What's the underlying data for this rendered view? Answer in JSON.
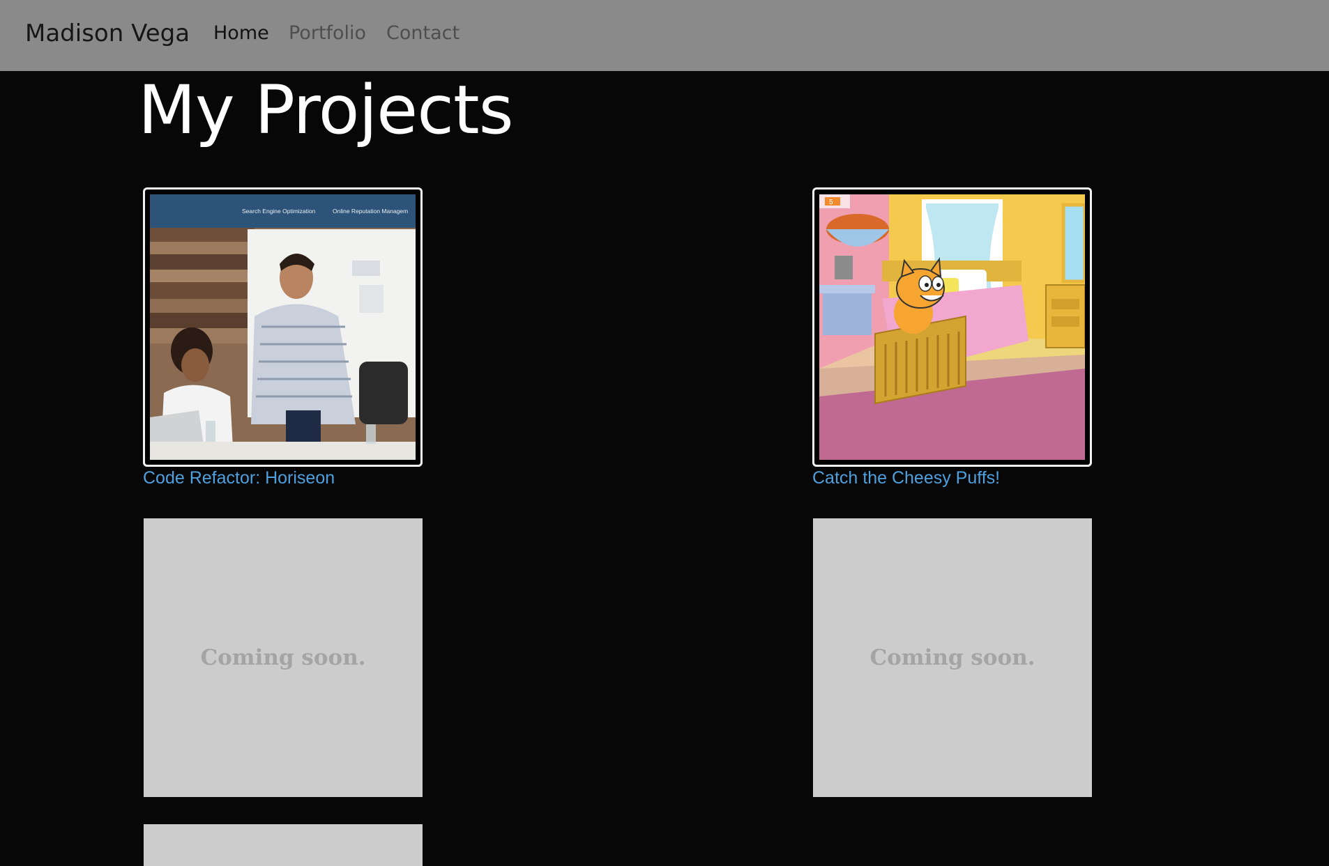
{
  "nav": {
    "brand": "Madison Vega",
    "links": [
      {
        "label": "Home",
        "active": true
      },
      {
        "label": "Portfolio",
        "active": false
      },
      {
        "label": "Contact",
        "active": false
      }
    ]
  },
  "main": {
    "title": "My Projects",
    "projects": [
      {
        "title": "Code Refactor: Horiseon",
        "thumbnail": {
          "menu_items": [
            "Search Engine Optimization",
            "Online Reputation Managem"
          ]
        }
      },
      {
        "title": "Catch the Cheesy Puffs!",
        "thumbnail": {
          "score": "5"
        }
      }
    ],
    "placeholders": [
      {
        "text": "Coming soon."
      },
      {
        "text": "Coming soon."
      },
      {
        "text": ""
      }
    ]
  },
  "colors": {
    "background": "#070707",
    "navbar": "#8a8a8a",
    "link": "#4ea0de",
    "placeholder": "#cccccc"
  }
}
